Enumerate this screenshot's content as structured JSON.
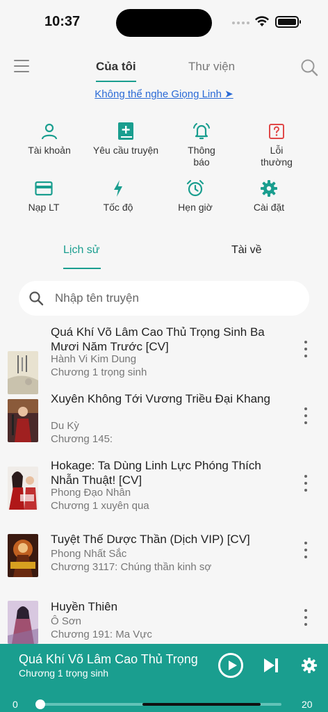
{
  "status_bar": {
    "time": "10:37"
  },
  "header": {
    "tabs": [
      {
        "label": "Của tôi",
        "active": true
      },
      {
        "label": "Thư viện",
        "active": false
      }
    ]
  },
  "notice": {
    "text": "Không thể nghe Giọng Linh ➤"
  },
  "actions": [
    {
      "label": "Tài khoản",
      "icon": "person-icon"
    },
    {
      "label": "Yêu cầu truyện",
      "icon": "book-add-icon"
    },
    {
      "label": "Thông báo",
      "icon": "bell-icon"
    },
    {
      "label": "Lỗi thường",
      "icon": "help-box-icon"
    },
    {
      "label": "Nạp LT",
      "icon": "card-icon"
    },
    {
      "label": "Tốc độ",
      "icon": "bolt-icon"
    },
    {
      "label": "Hẹn giờ",
      "icon": "alarm-icon"
    },
    {
      "label": "Cài đặt",
      "icon": "gear-icon"
    }
  ],
  "sub_tabs": [
    {
      "label": "Lịch sử",
      "active": true
    },
    {
      "label": "Tài về",
      "active": false
    }
  ],
  "search": {
    "placeholder": "Nhập tên truyện",
    "value": ""
  },
  "stories": [
    {
      "title": "Quá Khí Võ Lâm Cao Thủ Trọng Sinh Ba Mươi Năm Trước [CV]",
      "author": "Hành Vi Kim Dung",
      "chapter": "Chương 1 trọng sinh"
    },
    {
      "title": "Xuyên Không Tới Vương Triều Đại Khang",
      "author": "Du Kỳ",
      "chapter": "Chương 145:"
    },
    {
      "title": "Hokage: Ta Dùng Linh Lực Phóng Thích Nhẫn Thuật! [CV]",
      "author": "Phong Đạo Nhân",
      "chapter": "Chương 1 xuyên qua"
    },
    {
      "title": "Tuyệt Thế Dược Thần (Dịch VIP) [CV]",
      "author": "Phong Nhất Sắc",
      "chapter": "Chương 3117: Chúng thần kinh sợ"
    },
    {
      "title": "Huyền Thiên",
      "author": "Ô Sơn",
      "chapter": "Chương 191: Ma Vực"
    }
  ],
  "player": {
    "title": "Quá Khí Võ Lâm Cao Thủ Trọng",
    "chapter": "Chương 1 trọng sinh",
    "time_start": "0",
    "time_end": "20",
    "progress": 0
  },
  "colors": {
    "accent": "#1a9e8f",
    "link": "#2a6ad6",
    "error": "#e04848"
  }
}
